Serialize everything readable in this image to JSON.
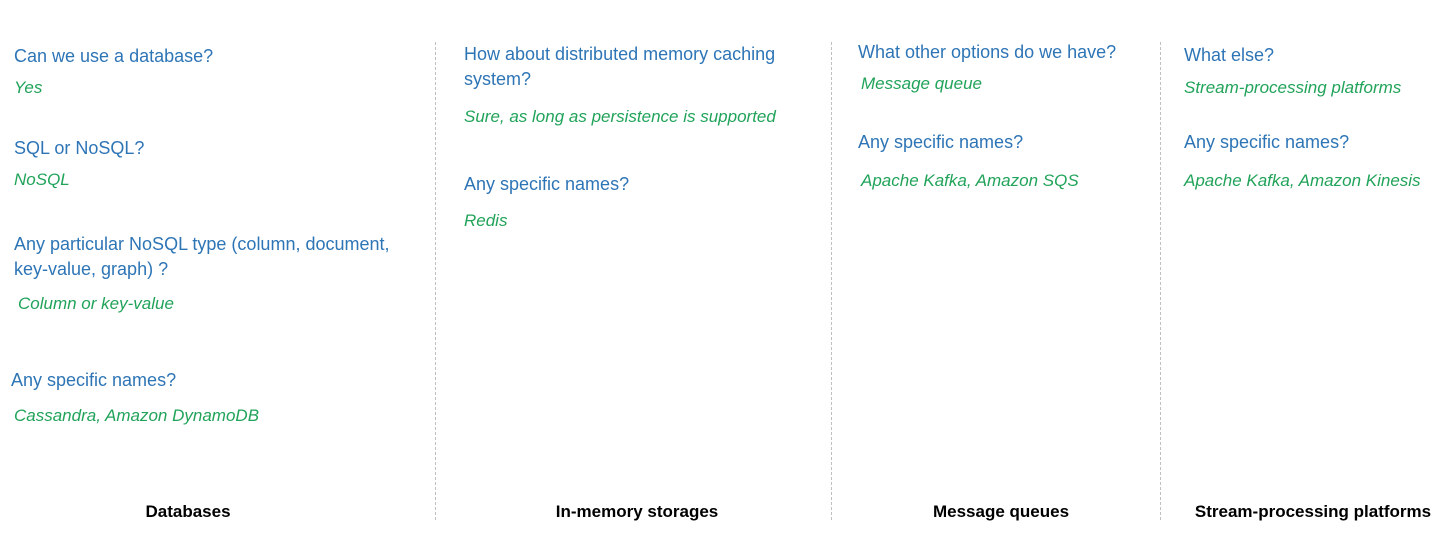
{
  "columns": [
    {
      "heading": "Databases",
      "qa": [
        {
          "q": "Can we use a database?",
          "a": "Yes"
        },
        {
          "q": "SQL or NoSQL?",
          "a": "NoSQL"
        },
        {
          "q": [
            "Any particular NoSQL type (column, document,",
            "key-value, graph) ?"
          ],
          "a": "Column or key-value"
        },
        {
          "q": "Any specific names?",
          "a": "Cassandra, Amazon DynamoDB"
        }
      ]
    },
    {
      "heading": "In-memory storages",
      "qa": [
        {
          "q": [
            "How about distributed memory caching",
            "system?"
          ],
          "a": "Sure, as long as persistence is supported"
        },
        {
          "q": "Any specific names?",
          "a": "Redis"
        }
      ]
    },
    {
      "heading": "Message queues",
      "qa": [
        {
          "q": "What other options do we have?",
          "a": "Message queue"
        },
        {
          "q": "Any specific names?",
          "a": "Apache Kafka, Amazon SQS"
        }
      ]
    },
    {
      "heading": "Stream-processing platforms",
      "qa": [
        {
          "q": "What else?",
          "a": "Stream-processing platforms"
        },
        {
          "q": "Any specific names?",
          "a": "Apache Kafka, Amazon Kinesis"
        }
      ]
    }
  ]
}
